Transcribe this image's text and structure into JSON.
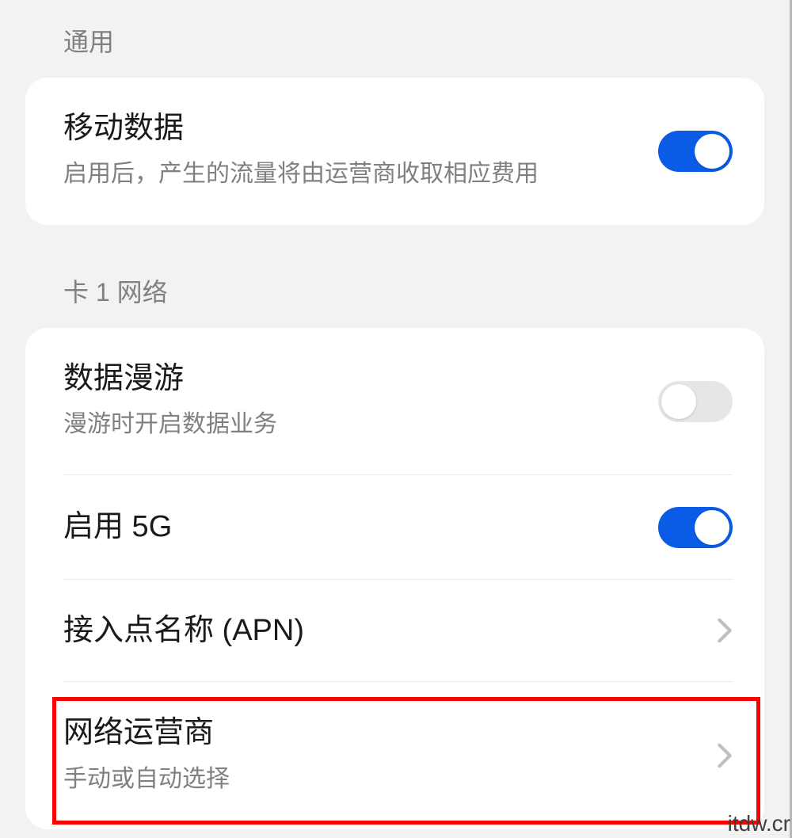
{
  "section_general": {
    "header": "通用",
    "mobile_data": {
      "title": "移动数据",
      "subtitle": "启用后，产生的流量将由运营商收取相应费用",
      "enabled": true
    }
  },
  "section_sim1": {
    "header": "卡 1 网络",
    "data_roaming": {
      "title": "数据漫游",
      "subtitle": "漫游时开启数据业务",
      "enabled": false
    },
    "enable_5g": {
      "title": "启用 5G",
      "enabled": true
    },
    "apn": {
      "title": "接入点名称 (APN)"
    },
    "carrier": {
      "title": "网络运营商",
      "subtitle": "手动或自动选择"
    }
  },
  "watermark": "itdw.cr"
}
